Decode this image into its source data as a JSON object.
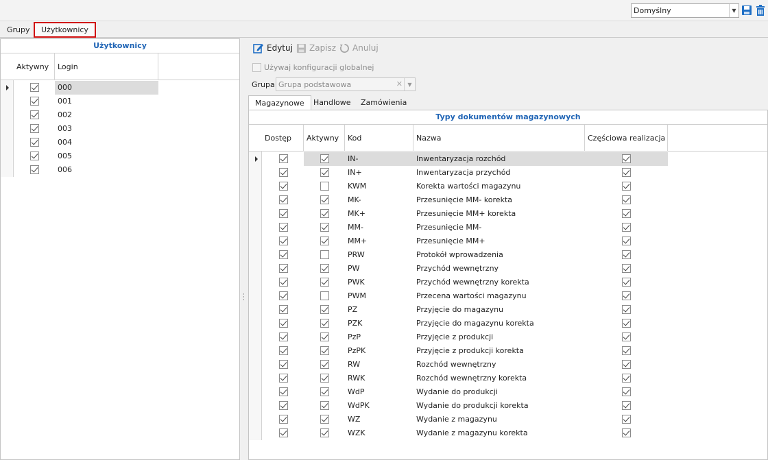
{
  "topbar": {
    "layout_select": "Domyślny"
  },
  "tabs": [
    {
      "label": "Grupy",
      "active": false
    },
    {
      "label": "Użytkownicy",
      "active": true
    }
  ],
  "users_panel": {
    "caption": "Użytkownicy",
    "columns": [
      "Aktywny",
      "Login"
    ],
    "rows": [
      {
        "active": true,
        "login": "000"
      },
      {
        "active": true,
        "login": "001"
      },
      {
        "active": true,
        "login": "002"
      },
      {
        "active": true,
        "login": "003"
      },
      {
        "active": true,
        "login": "004"
      },
      {
        "active": true,
        "login": "005"
      },
      {
        "active": true,
        "login": "006"
      }
    ]
  },
  "toolbar": {
    "edit_label": "Edytuj",
    "save_label": "Zapisz",
    "cancel_label": "Anuluj"
  },
  "config": {
    "global_label": "Używaj konfiguracji globalnej",
    "group_label": "Grupa",
    "group_value": "Grupa podstawowa"
  },
  "subtabs": [
    {
      "label": "Magazynowe",
      "active": true
    },
    {
      "label": "Handlowe",
      "active": false
    },
    {
      "label": "Zamówienia",
      "active": false
    }
  ],
  "doc_types": {
    "caption": "Typy dokumentów magazynowych",
    "columns": [
      "Dostęp",
      "Aktywny",
      "Kod",
      "Nazwa",
      "Częściowa realizacja"
    ],
    "rows": [
      {
        "access": true,
        "active": true,
        "code": "IN-",
        "name": "Inwentaryzacja rozchód",
        "partial": true
      },
      {
        "access": true,
        "active": true,
        "code": "IN+",
        "name": "Inwentaryzacja przychód",
        "partial": true
      },
      {
        "access": true,
        "active": false,
        "code": "KWM",
        "name": "Korekta wartości magazynu",
        "partial": true
      },
      {
        "access": true,
        "active": true,
        "code": "MK-",
        "name": "Przesunięcie MM- korekta",
        "partial": true
      },
      {
        "access": true,
        "active": true,
        "code": "MK+",
        "name": "Przesunięcie MM+ korekta",
        "partial": true
      },
      {
        "access": true,
        "active": true,
        "code": "MM-",
        "name": "Przesunięcie MM-",
        "partial": true
      },
      {
        "access": true,
        "active": true,
        "code": "MM+",
        "name": "Przesunięcie MM+",
        "partial": true
      },
      {
        "access": true,
        "active": false,
        "code": "PRW",
        "name": "Protokół wprowadzenia",
        "partial": true
      },
      {
        "access": true,
        "active": true,
        "code": "PW",
        "name": "Przychód wewnętrzny",
        "partial": true
      },
      {
        "access": true,
        "active": true,
        "code": "PWK",
        "name": "Przychód wewnętrzny korekta",
        "partial": true
      },
      {
        "access": true,
        "active": false,
        "code": "PWM",
        "name": "Przecena wartości magazynu",
        "partial": true
      },
      {
        "access": true,
        "active": true,
        "code": "PZ",
        "name": "Przyjęcie do magazynu",
        "partial": true
      },
      {
        "access": true,
        "active": true,
        "code": "PZK",
        "name": "Przyjęcie do magazynu korekta",
        "partial": true
      },
      {
        "access": true,
        "active": true,
        "code": "PzP",
        "name": "Przyjęcie z produkcji",
        "partial": true
      },
      {
        "access": true,
        "active": true,
        "code": "PzPK",
        "name": "Przyjęcie z produkcji korekta",
        "partial": true
      },
      {
        "access": true,
        "active": true,
        "code": "RW",
        "name": "Rozchód wewnętrzny",
        "partial": true
      },
      {
        "access": true,
        "active": true,
        "code": "RWK",
        "name": "Rozchód wewnętrzny korekta",
        "partial": true
      },
      {
        "access": true,
        "active": true,
        "code": "WdP",
        "name": "Wydanie do produkcji",
        "partial": true
      },
      {
        "access": true,
        "active": true,
        "code": "WdPK",
        "name": "Wydanie do produkcji korekta",
        "partial": true
      },
      {
        "access": true,
        "active": true,
        "code": "WZ",
        "name": "Wydanie z magazynu",
        "partial": true
      },
      {
        "access": true,
        "active": true,
        "code": "WZK",
        "name": "Wydanie z magazynu korekta",
        "partial": true
      }
    ]
  },
  "colors": {
    "accent": "#1f64b5",
    "active_tab_border": "#d01010",
    "selected_row": "#dcdcdc"
  },
  "icons": {
    "edit": "pencil-edit-icon",
    "save": "floppy-disk-icon",
    "cancel": "undo-icon",
    "delete": "trash-icon"
  }
}
